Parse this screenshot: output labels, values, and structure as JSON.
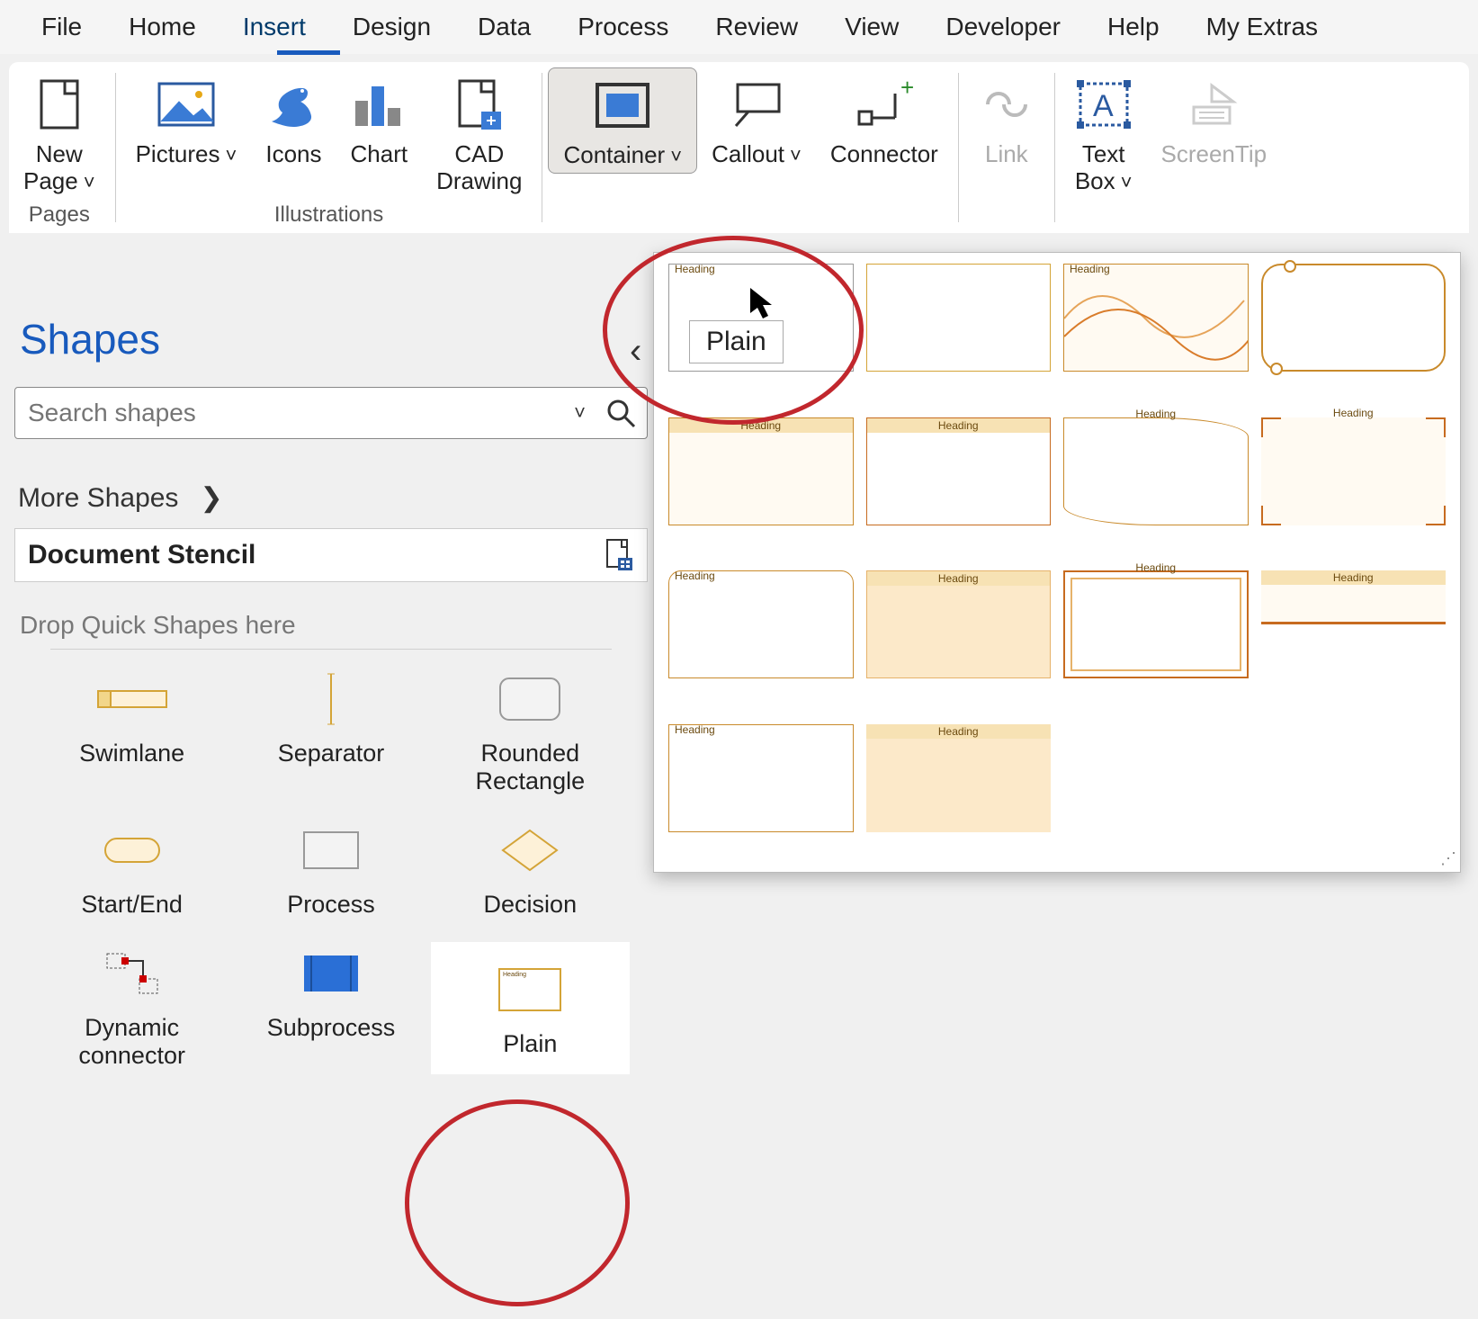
{
  "menu": [
    "File",
    "Home",
    "Insert",
    "Design",
    "Data",
    "Process",
    "Review",
    "View",
    "Developer",
    "Help",
    "My Extras"
  ],
  "active_menu": "Insert",
  "ribbon": {
    "pages": {
      "group": "Pages",
      "new_page": "New\nPage"
    },
    "illustrations": {
      "group": "Illustrations",
      "pictures": "Pictures",
      "icons": "Icons",
      "chart": "Chart",
      "cad": "CAD\nDrawing"
    },
    "diagram_parts": {
      "container": "Container",
      "callout": "Callout",
      "connector": "Connector"
    },
    "links": {
      "link": "Link"
    },
    "text": {
      "textbox": "Text\nBox",
      "screentip": "ScreenTip"
    }
  },
  "sidebar": {
    "title": "Shapes",
    "search_placeholder": "Search shapes",
    "more_shapes": "More Shapes",
    "doc_stencil": "Document Stencil",
    "drop_hint": "Drop Quick Shapes here",
    "shapes": [
      "Swimlane",
      "Separator",
      "Rounded\nRectangle",
      "Start/End",
      "Process",
      "Decision",
      "Dynamic\nconnector",
      "Subprocess",
      "Plain"
    ]
  },
  "tooltip": "Plain",
  "gallery_heading": "Heading"
}
